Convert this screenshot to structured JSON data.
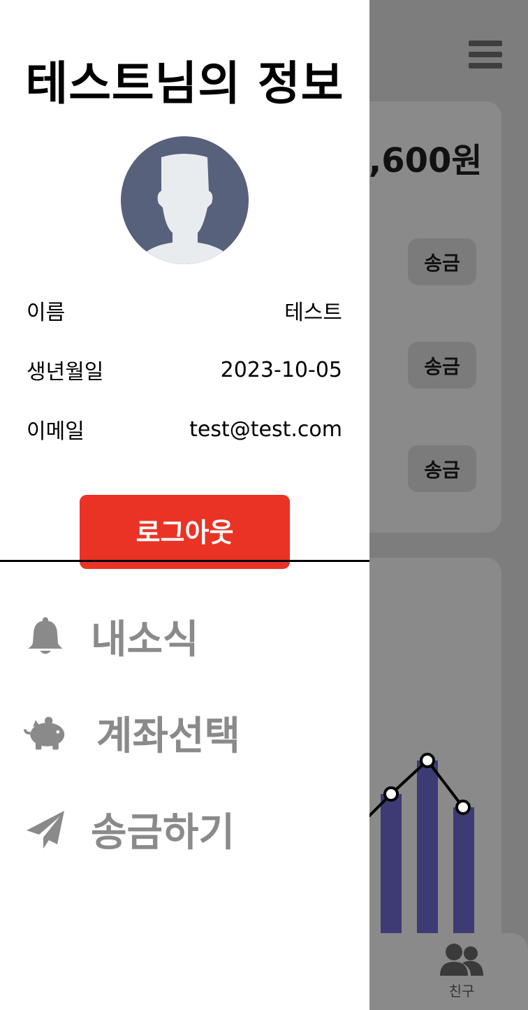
{
  "background": {
    "balance_amount": ",600원",
    "send_buttons": [
      "송금",
      "송금",
      "송금"
    ],
    "bottom_nav": {
      "friends_label": "친구"
    },
    "chart": {
      "bar_color": "#3d3b74"
    }
  },
  "drawer": {
    "title": "테스트님의 정보",
    "info": [
      {
        "label": "이름",
        "value": "테스트"
      },
      {
        "label": "생년월일",
        "value": "2023-10-05"
      },
      {
        "label": "이메일",
        "value": "test@test.com"
      }
    ],
    "logout_label": "로그아웃",
    "menu": [
      {
        "label": "내소식",
        "icon": "bell-icon"
      },
      {
        "label": "계좌선택",
        "icon": "piggy-bank-icon"
      },
      {
        "label": "송금하기",
        "icon": "paper-plane-icon"
      }
    ]
  },
  "colors": {
    "logout": "#ea3325",
    "menu_text": "#8a8a8a",
    "overlay": "#7d7d7d",
    "avatar_bg": "#58617b"
  }
}
